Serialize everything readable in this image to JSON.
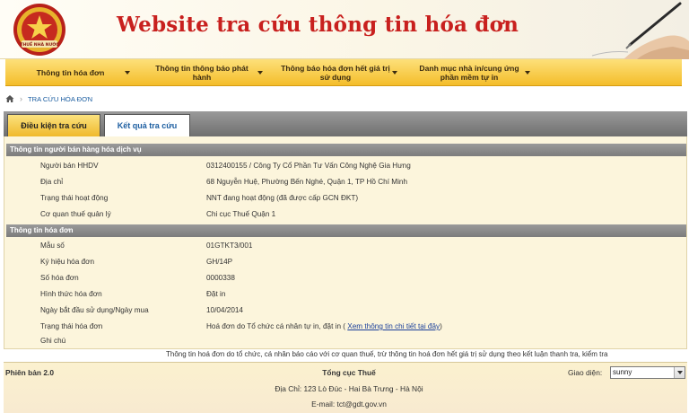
{
  "header": {
    "title": "Website tra cứu thông tin hóa đơn",
    "logo_text": "THUẾ NHÀ NƯỚC"
  },
  "nav": {
    "items": [
      {
        "label": "Thông tin hóa đơn"
      },
      {
        "label": "Thông tin thông báo phát hành"
      },
      {
        "label": "Thông báo hóa đơn hết giá trị sử dụng"
      },
      {
        "label": "Danh mục nhà in/cung ứng phần mềm tự in"
      }
    ]
  },
  "breadcrumb": {
    "current": "TRA CỨU HÓA ĐƠN"
  },
  "tabs": [
    {
      "label": "Điều kiện tra cứu",
      "active": false
    },
    {
      "label": "Kết quả tra cứu",
      "active": true
    }
  ],
  "seller_section": {
    "title": "Thông tin người bán hàng hóa dịch vụ",
    "rows": [
      {
        "label": "Người bán HHDV",
        "value": "0312400155 / Công Ty Cổ Phần Tư Vấn Công Nghệ Gia Hưng"
      },
      {
        "label": "Địa chỉ",
        "value": "68 Nguyễn Huệ, Phường Bến Nghé, Quận 1, TP Hồ Chí Minh"
      },
      {
        "label": "Trạng thái hoạt động",
        "value": "NNT đang hoạt động (đã được cấp GCN ĐKT)"
      },
      {
        "label": "Cơ quan thuế quản lý",
        "value": "Chi cục Thuế Quận 1"
      }
    ]
  },
  "invoice_section": {
    "title": "Thông tin hóa đơn",
    "rows": [
      {
        "label": "Mẫu số",
        "value": "01GTKT3/001"
      },
      {
        "label": "Ký hiệu hóa đơn",
        "value": "GH/14P"
      },
      {
        "label": "Số hóa đơn",
        "value": "0000338"
      },
      {
        "label": "Hình thức hóa đơn",
        "value": "Đặt in"
      },
      {
        "label": "Ngày bắt đầu sử dụng/Ngày mua",
        "value": "10/04/2014"
      },
      {
        "label": "Trạng thái hóa đơn",
        "value": "Hoá đơn do Tổ chức cá nhân tự in, đặt in (",
        "link": "Xem thông tin chi tiết tại đây",
        "value_suffix": ")"
      },
      {
        "label": "Ghi chú",
        "value": ""
      }
    ]
  },
  "notice": "Thông tin hoá đơn do tổ chức, cá nhân báo cáo với cơ quan thuế, trừ thông tin hoá đơn hết giá trị sử dụng theo kết luận thanh tra, kiểm tra",
  "footer": {
    "version": "Phiên bản 2.0",
    "org": "Tổng cục Thuế",
    "address": "Địa Chỉ: 123 Lò Đúc - Hai Bà Trưng - Hà Nội",
    "email": "E-mail: tct@gdt.gov.vn",
    "theme_label": "Giao diện:",
    "theme_value": "sunny"
  },
  "colors": {
    "title_red": "#c8201e",
    "nav_gold": "#f4bd2a",
    "content_bg": "#fcf5dc",
    "link_blue": "#1a3f9a"
  }
}
